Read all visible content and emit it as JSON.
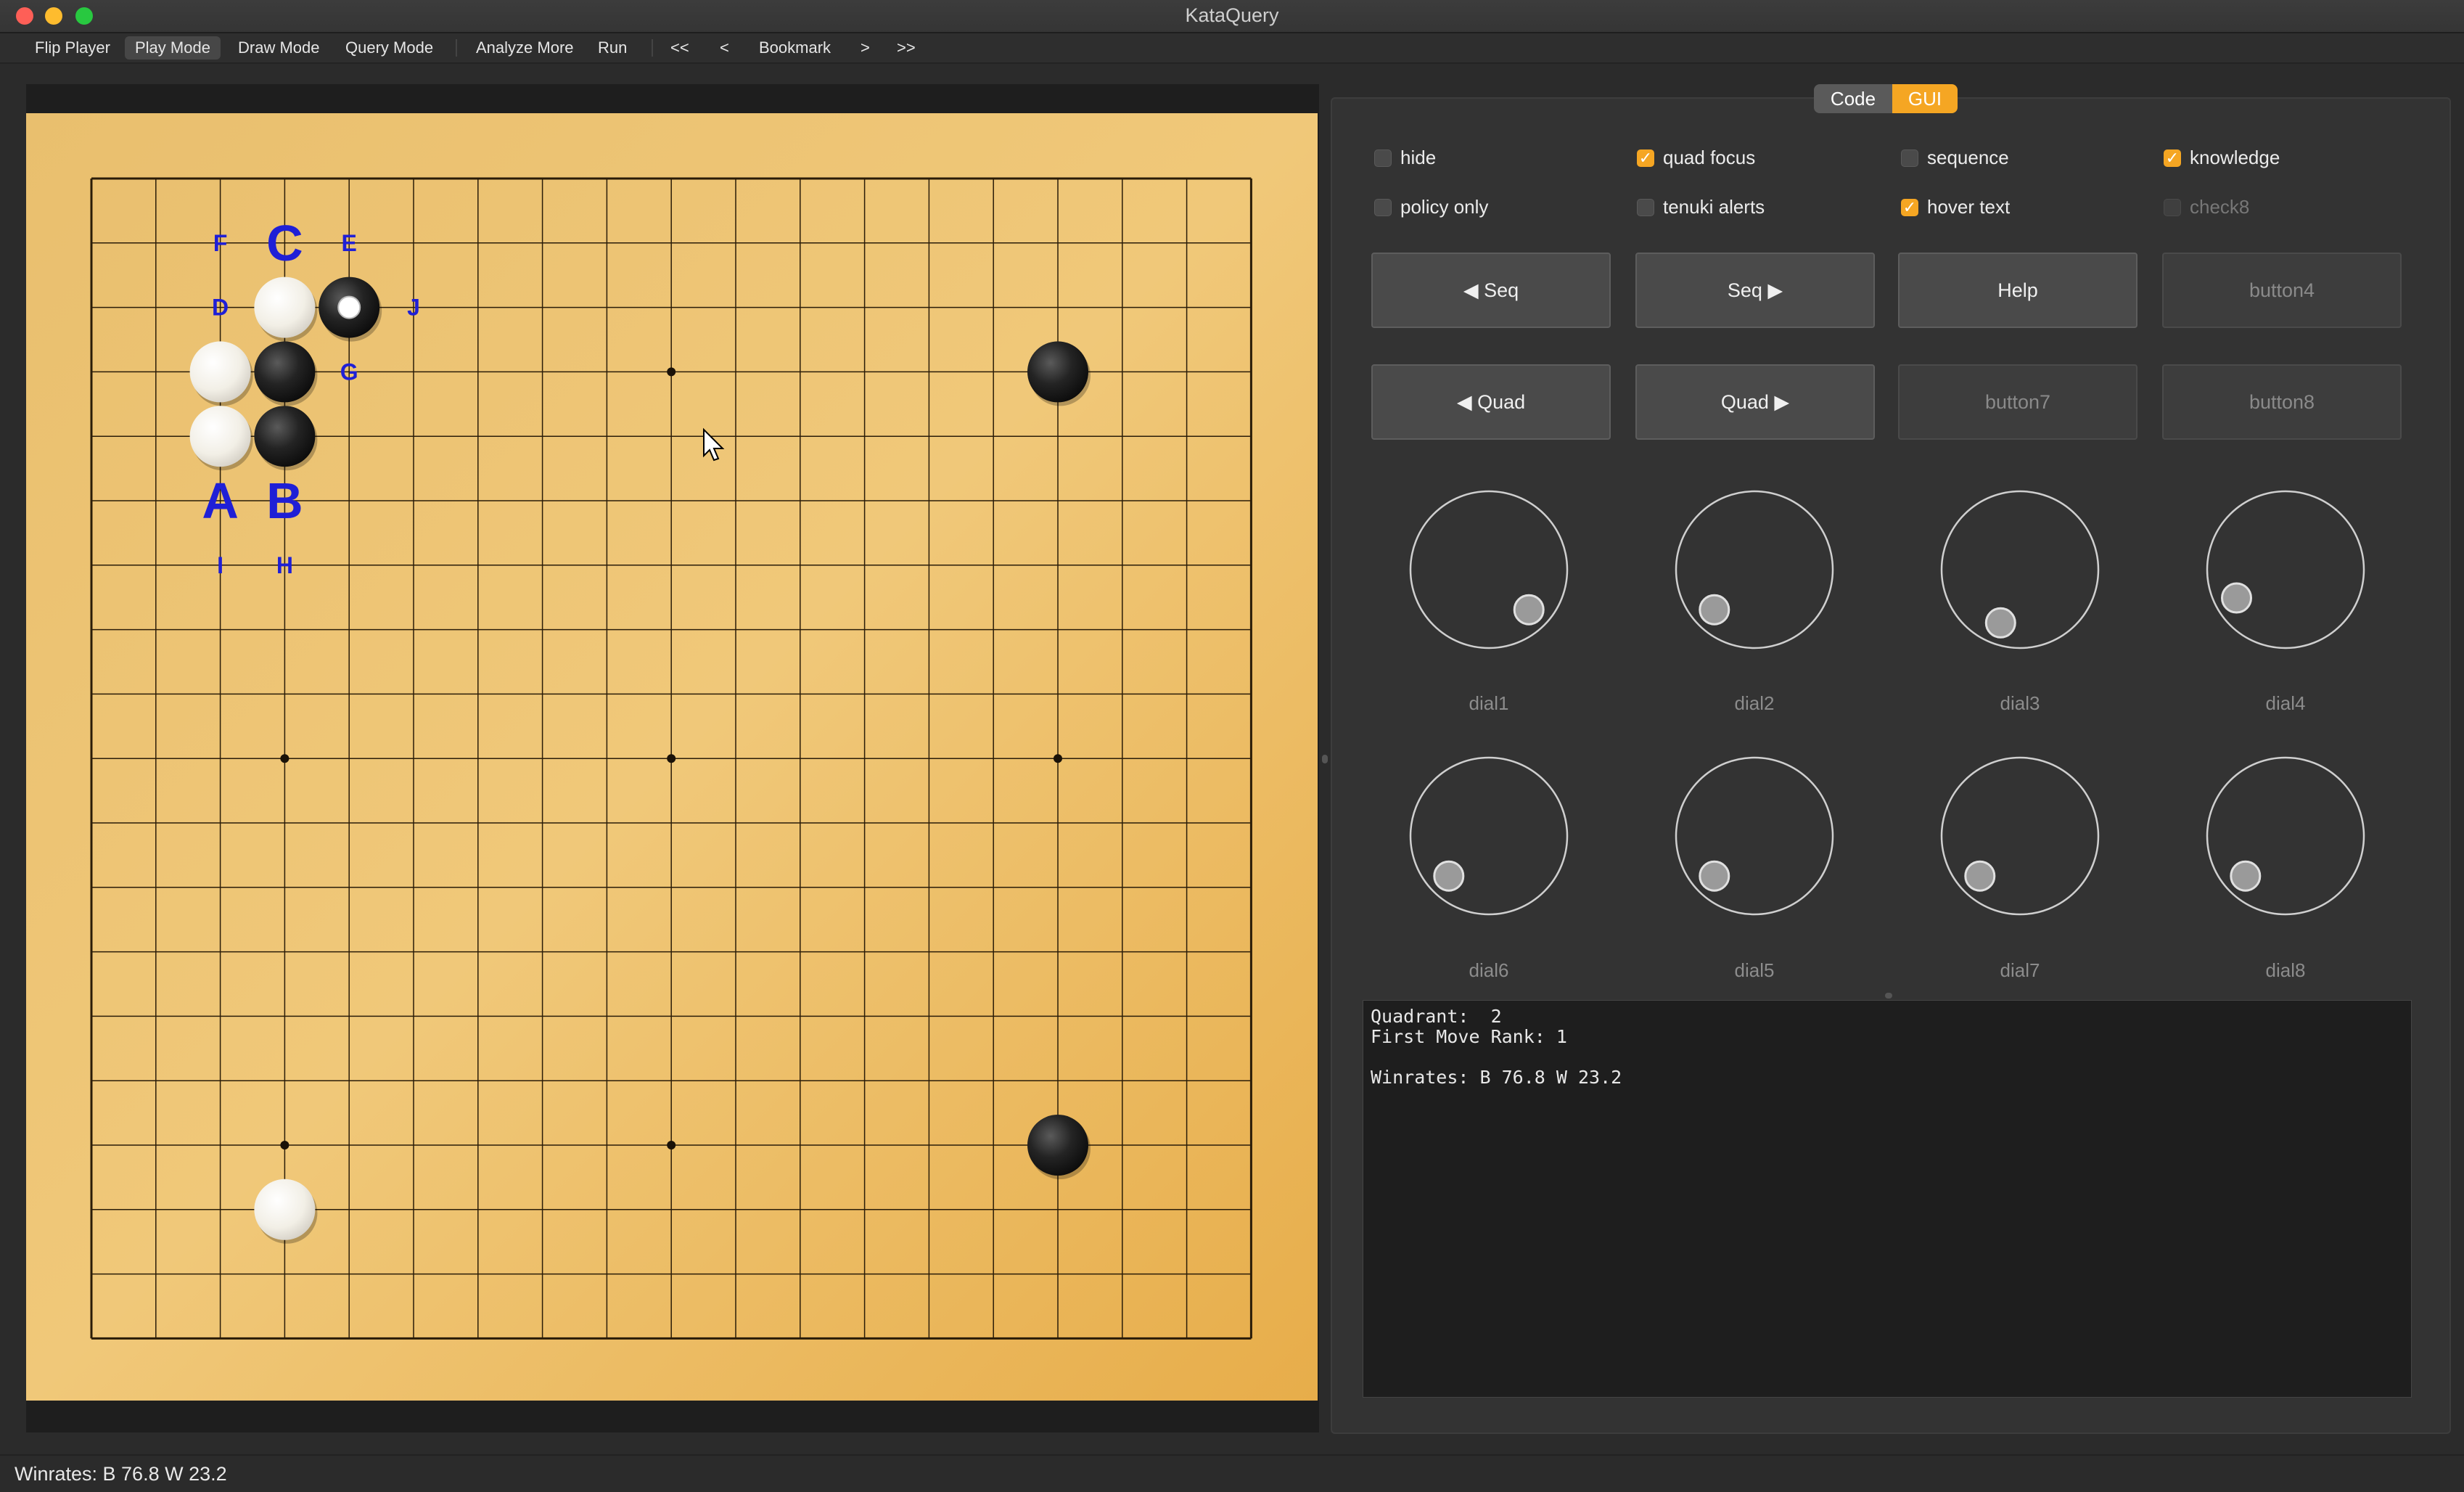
{
  "window": {
    "title": "KataQuery"
  },
  "toolbar": {
    "items": [
      "Flip Player",
      "Play Mode",
      "Draw Mode",
      "Query Mode",
      "Analyze More",
      "Run",
      "<<",
      "<",
      "Bookmark",
      ">",
      ">>"
    ],
    "active": "Play Mode"
  },
  "board": {
    "size": 19,
    "star_points": [
      [
        3,
        3
      ],
      [
        9,
        3
      ],
      [
        15,
        3
      ],
      [
        3,
        9
      ],
      [
        9,
        9
      ],
      [
        15,
        9
      ],
      [
        3,
        15
      ],
      [
        9,
        15
      ],
      [
        15,
        15
      ]
    ],
    "stones": [
      {
        "color": "white",
        "col": 3,
        "row": 2
      },
      {
        "color": "black",
        "col": 4,
        "row": 2,
        "last_move": true
      },
      {
        "color": "white",
        "col": 2,
        "row": 3
      },
      {
        "color": "black",
        "col": 3,
        "row": 3
      },
      {
        "color": "white",
        "col": 2,
        "row": 4
      },
      {
        "color": "black",
        "col": 3,
        "row": 4
      },
      {
        "color": "black",
        "col": 15,
        "row": 3
      },
      {
        "color": "black",
        "col": 15,
        "row": 15
      },
      {
        "color": "white",
        "col": 3,
        "row": 16
      }
    ],
    "labels": [
      {
        "text": "F",
        "col": 2,
        "row": 1,
        "big": false
      },
      {
        "text": "C",
        "col": 3,
        "row": 1,
        "big": true
      },
      {
        "text": "E",
        "col": 4,
        "row": 1,
        "big": false
      },
      {
        "text": "D",
        "col": 2,
        "row": 2,
        "big": false
      },
      {
        "text": "J",
        "col": 5,
        "row": 2,
        "big": false
      },
      {
        "text": "G",
        "col": 4,
        "row": 3,
        "big": false
      },
      {
        "text": "A",
        "col": 2,
        "row": 5,
        "big": true
      },
      {
        "text": "B",
        "col": 3,
        "row": 5,
        "big": true
      },
      {
        "text": "I",
        "col": 2,
        "row": 6,
        "big": false
      },
      {
        "text": "H",
        "col": 3,
        "row": 6,
        "big": false
      }
    ],
    "label_color": "#1f1fd6"
  },
  "tabs": {
    "code": "Code",
    "gui": "GUI",
    "active": "GUI"
  },
  "checkboxes": [
    {
      "label": "hide",
      "checked": false,
      "enabled": true
    },
    {
      "label": "quad focus",
      "checked": true,
      "enabled": true
    },
    {
      "label": "sequence",
      "checked": false,
      "enabled": true
    },
    {
      "label": "knowledge",
      "checked": true,
      "enabled": true
    },
    {
      "label": "policy only",
      "checked": false,
      "enabled": true
    },
    {
      "label": "tenuki alerts",
      "checked": false,
      "enabled": true
    },
    {
      "label": "hover text",
      "checked": true,
      "enabled": true
    },
    {
      "label": "check8",
      "checked": false,
      "enabled": false
    }
  ],
  "buttons": [
    {
      "label": "◀ Seq",
      "enabled": true
    },
    {
      "label": "Seq ▶",
      "enabled": true
    },
    {
      "label": "Help",
      "enabled": true
    },
    {
      "label": "button4",
      "enabled": false
    },
    {
      "label": "◀ Quad",
      "enabled": true
    },
    {
      "label": "Quad ▶",
      "enabled": true
    },
    {
      "label": "button7",
      "enabled": false
    },
    {
      "label": "button8",
      "enabled": false
    }
  ],
  "dials": [
    {
      "label": "dial1",
      "angle_deg": 315
    },
    {
      "label": "dial2",
      "angle_deg": 225
    },
    {
      "label": "dial3",
      "angle_deg": 250
    },
    {
      "label": "dial4",
      "angle_deg": 210
    },
    {
      "label": "dial6",
      "angle_deg": 225
    },
    {
      "label": "dial5",
      "angle_deg": 225
    },
    {
      "label": "dial7",
      "angle_deg": 225
    },
    {
      "label": "dial8",
      "angle_deg": 225
    }
  ],
  "output": {
    "text": "Quadrant:  2\nFirst Move Rank: 1\n\nWinrates: B 76.8 W 23.2"
  },
  "status": {
    "text": "Winrates: B 76.8 W 23.2"
  }
}
